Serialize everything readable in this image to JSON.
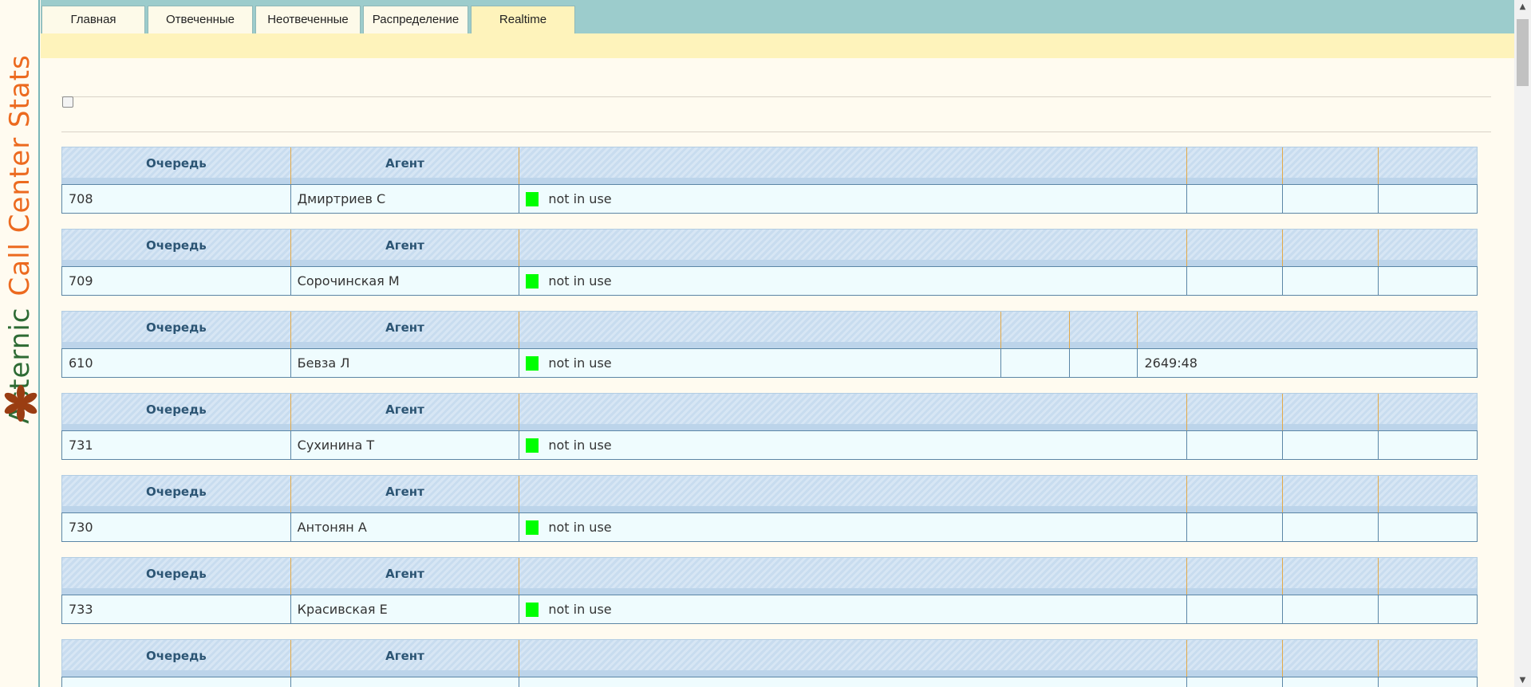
{
  "brand": {
    "word1": "Asternic",
    "word2": "Call Center Stats"
  },
  "tabs": [
    {
      "label": "Главная",
      "active": false
    },
    {
      "label": "Отвеченные",
      "active": false
    },
    {
      "label": "Неотвеченные",
      "active": false
    },
    {
      "label": "Распределение",
      "active": false
    },
    {
      "label": "Realtime",
      "active": true
    }
  ],
  "table_headers": {
    "queue": "Очередь",
    "agent": "Агент"
  },
  "agents": [
    {
      "queue": "708",
      "agent": "Дмиртриев С",
      "status": "not in use",
      "extra": [
        "",
        "",
        ""
      ]
    },
    {
      "queue": "709",
      "agent": "Сорочинская М",
      "status": "not in use",
      "extra": [
        "",
        "",
        ""
      ]
    },
    {
      "queue": "610",
      "agent": "Бевза Л",
      "status": "not in use",
      "extra": [
        "",
        "",
        "2649:48"
      ]
    },
    {
      "queue": "731",
      "agent": "Сухинина Т",
      "status": "not in use",
      "extra": [
        "",
        "",
        ""
      ]
    },
    {
      "queue": "730",
      "agent": "Антонян А",
      "status": "not in use",
      "extra": [
        "",
        "",
        ""
      ]
    },
    {
      "queue": "733",
      "agent": "Красивская Е",
      "status": "not in use",
      "extra": [
        "",
        "",
        ""
      ]
    },
    {
      "queue": "",
      "agent": "",
      "status": "",
      "extra": [
        "",
        "",
        ""
      ]
    }
  ],
  "colors": {
    "status_ok": "#00ff00",
    "brand_green": "#2e6b34",
    "brand_orange": "#ec6a1f"
  },
  "icons": {
    "brand": "asterisk-icon",
    "scroll_up": "arrow-up-icon",
    "scroll_down": "arrow-down-icon"
  }
}
